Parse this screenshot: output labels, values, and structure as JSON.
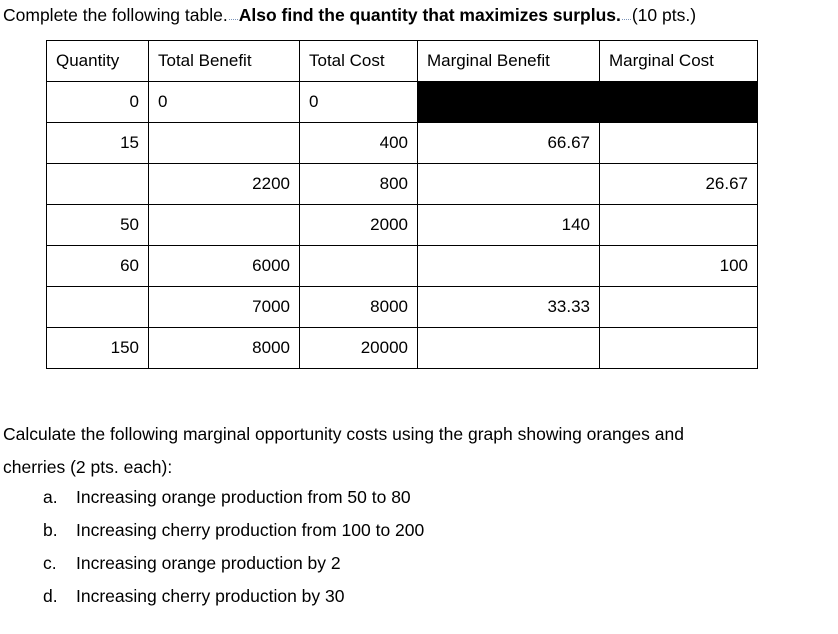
{
  "question1": {
    "text_before": "Complete the following table.",
    "dotted_mark_1": "spelling-dot-mark",
    "bold_text": "Also find the quantity that maximizes surplus.",
    "dotted_mark_2": "spelling-dot-mark",
    "points": "(10 pts.)"
  },
  "table": {
    "headers": [
      "Quantity",
      "Total Benefit",
      "Total Cost",
      "Marginal Benefit",
      "Marginal Cost"
    ],
    "rows": [
      {
        "quantity": "0",
        "total_benefit": "0",
        "total_cost": "0",
        "marginal_benefit": "",
        "marginal_cost": "",
        "tb_bold": true,
        "tc_bold": true,
        "tb_align": "left",
        "tc_align": "left",
        "mb_blacked": true,
        "mc_blacked": true
      },
      {
        "quantity": "15",
        "total_benefit": "",
        "total_cost": "400",
        "marginal_benefit": "66.67",
        "marginal_cost": "",
        "tb_bold": false,
        "tc_bold": false,
        "tb_align": "right",
        "tc_align": "right",
        "mb_blacked": false,
        "mc_blacked": false
      },
      {
        "quantity": "",
        "total_benefit": "2200",
        "total_cost": "800",
        "marginal_benefit": "",
        "marginal_cost": "26.67",
        "tb_bold": false,
        "tc_bold": false,
        "tb_align": "right",
        "tc_align": "right",
        "mb_blacked": false,
        "mc_blacked": false
      },
      {
        "quantity": "50",
        "total_benefit": "",
        "total_cost": "2000",
        "marginal_benefit": "140",
        "marginal_cost": "",
        "tb_bold": false,
        "tc_bold": false,
        "tb_align": "right",
        "tc_align": "right",
        "mb_blacked": false,
        "mc_blacked": false
      },
      {
        "quantity": "60",
        "total_benefit": "6000",
        "total_cost": "",
        "marginal_benefit": "",
        "marginal_cost": "100",
        "tb_bold": false,
        "tc_bold": false,
        "tb_align": "right",
        "tc_align": "right",
        "mb_blacked": false,
        "mc_blacked": false
      },
      {
        "quantity": "",
        "total_benefit": "7000",
        "total_cost": "8000",
        "marginal_benefit": "33.33",
        "marginal_cost": "",
        "tb_bold": false,
        "tc_bold": false,
        "tb_align": "right",
        "tc_align": "right",
        "mb_blacked": false,
        "mc_blacked": false
      },
      {
        "quantity": "150",
        "total_benefit": "8000",
        "total_cost": "20000",
        "marginal_benefit": "",
        "marginal_cost": "",
        "tb_bold": false,
        "tc_bold": false,
        "tb_align": "right",
        "tc_align": "right",
        "mb_blacked": false,
        "mc_blacked": false
      }
    ]
  },
  "question2": {
    "paragraph_line1": "Calculate the following marginal opportunity costs using the graph showing oranges and",
    "paragraph_line2": "cherries (2 pts. each):",
    "items": [
      {
        "marker": "a.",
        "text": "Increasing orange production from 50 to 80"
      },
      {
        "marker": "b.",
        "text": "Increasing cherry production from 100 to 200"
      },
      {
        "marker": "c.",
        "text": "Increasing orange production by 2"
      },
      {
        "marker": "d.",
        "text": "Increasing cherry production by 30"
      }
    ]
  },
  "colors": {
    "text": "#000000",
    "background": "#ffffff",
    "table_border": "#000000",
    "blacked_cell": "#000000",
    "spell_dot": "#7a93b8"
  }
}
